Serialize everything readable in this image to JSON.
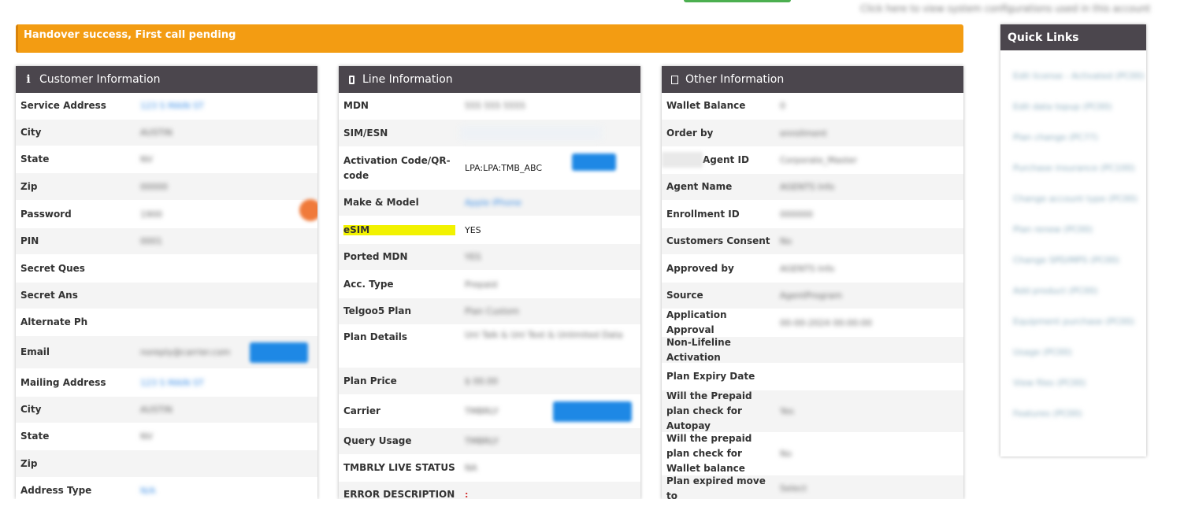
{
  "top": {
    "config_link": "Click here to view system configurations used in this account"
  },
  "alert": {
    "text": "Handover success, First call pending"
  },
  "customer": {
    "title": "Customer Information",
    "rows": [
      {
        "label": "Service Address",
        "value": "123 S MAIN ST"
      },
      {
        "label": "City",
        "value": "AUSTIN"
      },
      {
        "label": "State",
        "value": "NV"
      },
      {
        "label": "Zip",
        "value": "00000"
      },
      {
        "label": "Password",
        "value": "1900"
      },
      {
        "label": "PIN",
        "value": "0001"
      },
      {
        "label": "Secret Ques",
        "value": ""
      },
      {
        "label": "Secret Ans",
        "value": ""
      },
      {
        "label": "Alternate Ph",
        "value": ""
      },
      {
        "label": "Email",
        "value": "noreply@carrier.com"
      },
      {
        "label": "Mailing Address",
        "value": "123 S MAIN ST"
      },
      {
        "label": "City",
        "value": "AUSTIN"
      },
      {
        "label": "State",
        "value": "NV"
      },
      {
        "label": "Zip",
        "value": ""
      },
      {
        "label": "Address Type",
        "value": "N/A"
      }
    ]
  },
  "line": {
    "title": "Line Information",
    "rows": [
      {
        "label": "MDN",
        "value": "555 555 5555"
      },
      {
        "label": "SIM/ESN",
        "value": ""
      },
      {
        "label": "Activation Code/QR-code",
        "value": "LPA:LPA:TMB_ABC"
      },
      {
        "label": "Make & Model",
        "value": "Apple iPhone"
      },
      {
        "label": "eSIM",
        "value": "YES"
      },
      {
        "label": "Ported MDN",
        "value": "YES"
      },
      {
        "label": "Acc. Type",
        "value": "Prepaid"
      },
      {
        "label": "Telgoo5 Plan",
        "value": "Plan Custom"
      },
      {
        "label": "Plan Details",
        "value": "Unl Talk & Unl Text & Unlimited Data"
      },
      {
        "label": "Plan Price",
        "value": "$ 00.00"
      },
      {
        "label": "Carrier",
        "value": "TMBRLY"
      },
      {
        "label": "Query Usage",
        "value": "TMBRLY"
      },
      {
        "label": "TMBRLY LIVE STATUS",
        "value": "NA"
      },
      {
        "label": "ERROR DESCRIPTION",
        "value": ":"
      }
    ]
  },
  "other": {
    "title": "Other Information",
    "rows": [
      {
        "label": "Wallet Balance",
        "value": "0"
      },
      {
        "label": "Order by",
        "value": "enrollment"
      },
      {
        "label": "Agent ID",
        "value": "Corporate_Master"
      },
      {
        "label": "Agent Name",
        "value": "AGENTS Info"
      },
      {
        "label": "Enrollment ID",
        "value": "000000"
      },
      {
        "label": "Customers Consent",
        "value": "No"
      },
      {
        "label": "Approved by",
        "value": "AGENTS Info"
      },
      {
        "label": "Source",
        "value": "AgentProgram"
      },
      {
        "label": "Application Approval",
        "value": "00-00-2024 00:00:00"
      },
      {
        "label": "Non-Lifeline Activation",
        "value": ""
      },
      {
        "label": "Plan Expiry Date",
        "value": ""
      },
      {
        "label": "Will the Prepaid plan check for Autopay",
        "value": "Yes"
      },
      {
        "label": "Will the prepaid plan check for Wallet balance",
        "value": "No"
      },
      {
        "label": "Plan expired move to",
        "value": "Select"
      }
    ]
  },
  "quick_links": {
    "title": "Quick Links",
    "items": [
      "Edit license - Activated (PC00)",
      "Edit data topup (PC00)",
      "Plan change (PC77)",
      "Purchase insurance (PC100)",
      "Change account type (PC00)",
      "Plan renew (PC00)",
      "Change SPD/MPS (PC00)",
      "Add product (PC00)",
      "Equipment purchase (PC00)",
      "Usage (PC00)",
      "View files (PC00)",
      "Features (PC00)"
    ]
  }
}
